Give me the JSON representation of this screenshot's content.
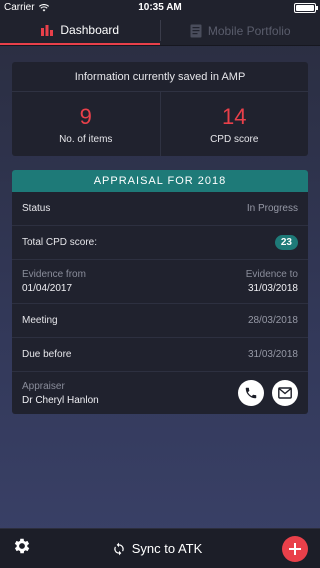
{
  "status_bar": {
    "carrier": "Carrier",
    "time": "10:35 AM"
  },
  "tabs": [
    {
      "label": "Dashboard",
      "active": true,
      "icon": "bar-chart-icon"
    },
    {
      "label": "Mobile Portfolio",
      "active": false,
      "icon": "document-icon"
    }
  ],
  "info": {
    "heading": "Information currently saved in AMP",
    "items_count": "9",
    "items_label": "No. of items",
    "cpd_score": "14",
    "cpd_label": "CPD score"
  },
  "appraisal": {
    "title": "APPRAISAL FOR 2018",
    "status_label": "Status",
    "status_value": "In Progress",
    "total_cpd_label": "Total CPD score:",
    "total_cpd_value": "23",
    "evidence_from_label": "Evidence from",
    "evidence_from_value": "01/04/2017",
    "evidence_to_label": "Evidence to",
    "evidence_to_value": "31/03/2018",
    "meeting_label": "Meeting",
    "meeting_value": "28/03/2018",
    "due_label": "Due before",
    "due_value": "31/03/2018",
    "appraiser_label": "Appraiser",
    "appraiser_name": "Dr Cheryl Hanlon"
  },
  "bottom": {
    "sync_label": "Sync to ATK"
  },
  "colors": {
    "accent_red": "#e9404a",
    "teal": "#1e7a78",
    "card_bg": "#20222e"
  }
}
